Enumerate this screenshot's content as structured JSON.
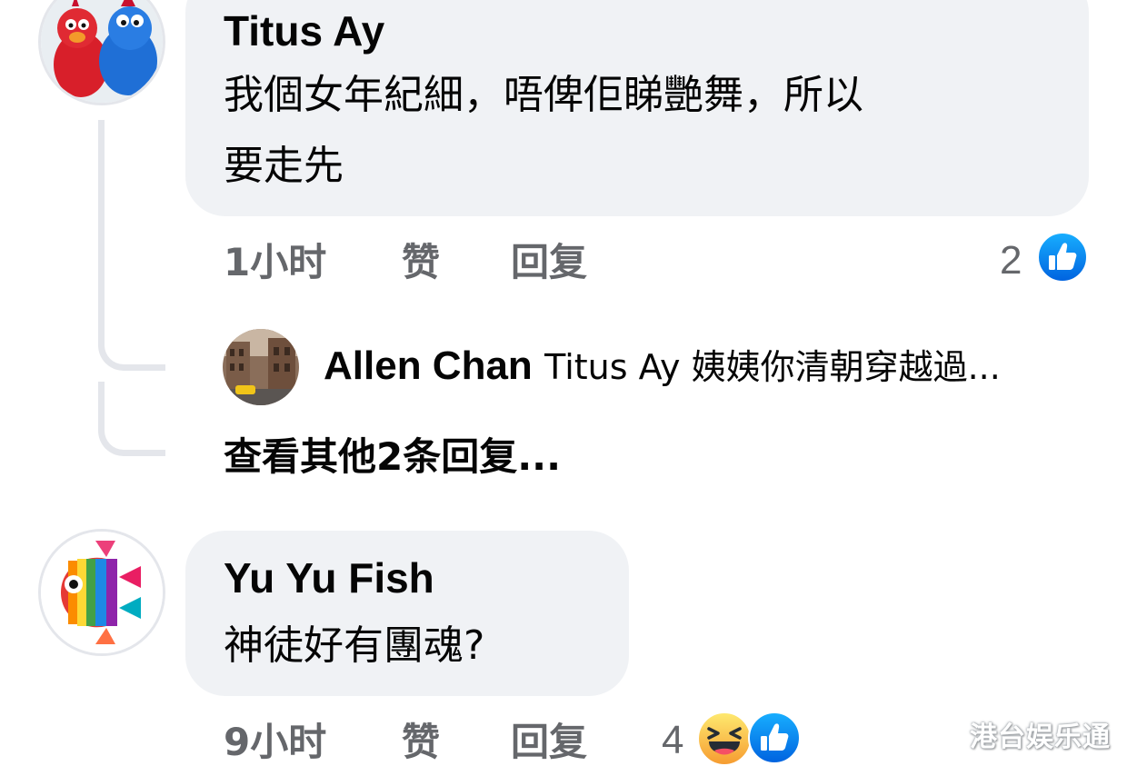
{
  "comments": [
    {
      "author": "Titus Ay",
      "text_lines": [
        "我個女年紀細，唔俾佢睇艷舞，所以",
        "要走先"
      ],
      "time": "1小时",
      "like_label": "赞",
      "reply_label": "回复",
      "reaction_count": "2",
      "reactions": [
        "like-icon"
      ]
    },
    {
      "author": "Yu Yu Fish",
      "text_lines": [
        "神徒好有團魂?"
      ],
      "time": "9小时",
      "like_label": "赞",
      "reply_label": "回复",
      "reaction_count": "4",
      "reactions": [
        "haha-icon",
        "like-icon"
      ]
    }
  ],
  "reply_preview": {
    "author": "Allen Chan",
    "text": "Titus Ay 姨姨你清朝穿越過..."
  },
  "more_replies_label": "查看其他2条回复...",
  "watermark": "港台娱乐通",
  "colors": {
    "bubble": "#f0f2f5",
    "text": "#050505",
    "secondary": "#65676b",
    "like_blue": "#1877f2",
    "haha_yellow": "#f7b928",
    "thread_line": "#e4e6eb"
  }
}
